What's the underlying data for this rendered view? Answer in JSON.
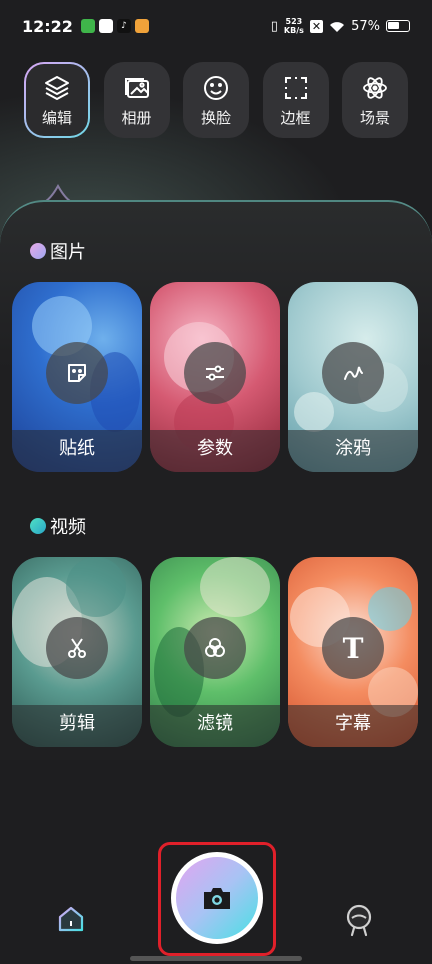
{
  "status_bar": {
    "time": "12:22",
    "net_speed_value": "523",
    "net_speed_unit": "KB/s",
    "battery": "57%"
  },
  "toolbar": {
    "items": [
      {
        "label": "编辑",
        "icon": "layers-icon",
        "active": true
      },
      {
        "label": "相册",
        "icon": "gallery-icon",
        "active": false
      },
      {
        "label": "换脸",
        "icon": "smile-icon",
        "active": false
      },
      {
        "label": "边框",
        "icon": "frame-icon",
        "active": false
      },
      {
        "label": "场景",
        "icon": "atom-icon",
        "active": false
      }
    ]
  },
  "sections": {
    "picture": {
      "title": "图片",
      "cards": [
        {
          "label": "贴纸",
          "icon": "sticker-icon"
        },
        {
          "label": "参数",
          "icon": "sliders-icon"
        },
        {
          "label": "涂鸦",
          "icon": "doodle-icon"
        }
      ]
    },
    "video": {
      "title": "视频",
      "cards": [
        {
          "label": "剪辑",
          "icon": "scissors-icon"
        },
        {
          "label": "滤镜",
          "icon": "filter-icon"
        },
        {
          "label": "字幕",
          "icon": "text-icon",
          "glyph": "T"
        }
      ]
    }
  },
  "bottom_nav": {
    "home_icon": "home-icon",
    "camera_icon": "camera-icon",
    "profile_icon": "profile-icon"
  },
  "colors": {
    "background": "#1e1e20",
    "accent_start": "#e2a5f0",
    "accent_end": "#48e0e4",
    "highlight_frame": "#e0202a"
  }
}
